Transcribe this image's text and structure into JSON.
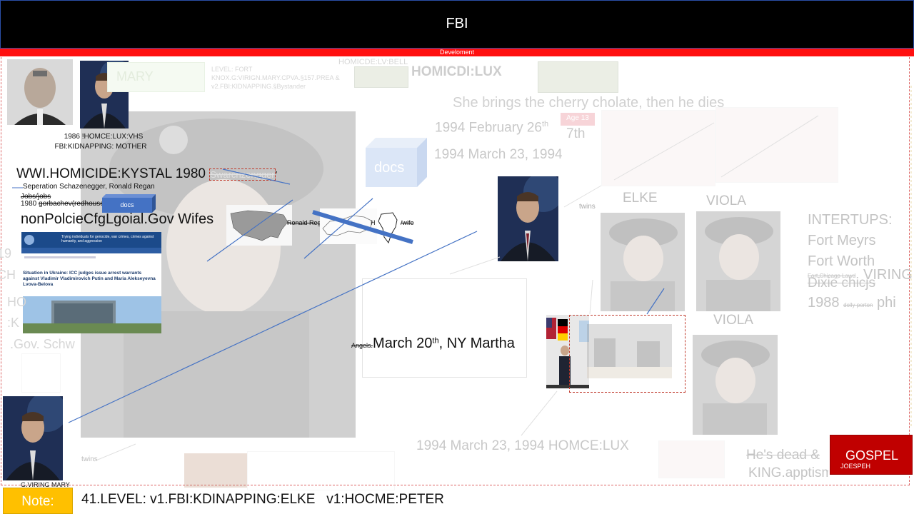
{
  "header": {
    "title": "FBI",
    "banner": "Develoment"
  },
  "left": {
    "photo_caption_line1": "1986 !HOMCE:LUX:VHS",
    "photo_caption_line2": "FBI:KIDNAPPING: MOTHER",
    "homicide_heading": "WWI.HOMICIDE:KYSTAL 1980",
    "homicide_struck": "Swarchzengger",
    "separation_note": "Seperation Schazenegger, Ronald Regan",
    "jobs_note": "Jobs/jobs",
    "year_note_prefix": "1980",
    "year_note_struck": "gorbachev(redhouse",
    "docs_small": "docs",
    "wifes_heading": "nonPolcieCfgLgoial.Gov Wifes",
    "map_label_regan": "Ronald Regan",
    "map_label_h": "H",
    "map_label_wife": "/wife",
    "news_article": {
      "header_text": "Trying individuals for genocide, war crimes, crimes against humanity, and aggression",
      "headline": "Situation in Ukraine: ICC judges issue arrest warrants against Vladimir Vladimirovich Putin and Maria Alekseyevna Lvova-Belova"
    },
    "ghost_left_1": "19",
    "ghost_left_2": "CH",
    "ghost_left_3": "HO",
    "ghost_left_4": ":K",
    "ghost_left_5": ".Gov. Schw",
    "twins_bottom": "twins",
    "bottom_caption": "G.VIRING MARY"
  },
  "center": {
    "ghost_mary": "MARY",
    "ghost_level": "LEVEL: FORT KNOX.G:VIRIGN.MARY.CPVA.§157.PREA & v2.FBI:KIDNAPPING.§Bystander",
    "ghost_bell": "HOMICDE:LV:BELL",
    "homicide_lux": "HOMICDI:LUX",
    "cherry_line": "She brings the cherry cholate, then he dies",
    "age_badge": "Age 13",
    "date_feb": "1994 February 26",
    "date_feb_sup": "th",
    "date_7th": "7th",
    "date_march": "1994 March 23, 1994",
    "docs_big": "docs",
    "angels_struck": "Angels.",
    "march_text": "March 20",
    "march_sup": "th",
    "march_rest": ", NY Martha",
    "twins_mid": "twins",
    "bottom_date": "1994 March 23, 1994 HOMCE:LUX"
  },
  "right": {
    "label_elke": "ELKE",
    "label_viola_1": "VIOLA",
    "label_viola_2": "VIOLA",
    "intertups_title": "INTERTUPS:",
    "intertups_1": "Fort Meyrs",
    "intertups_2": "Fort Worth",
    "intertups_struck_small": "Fort Chicagp Lawd",
    "intertups_struck": "Dixie chicjs",
    "viring": "VIRING",
    "year_1988": "1988",
    "dolly": "dolly porton",
    "phi": "phi",
    "hes_dead": "He's dead &",
    "king_line": "KING.apptism.2.MARY.",
    "gospel_title": "GOSPEL",
    "gospel_sub": "JOESPEH"
  },
  "footer": {
    "note_label": "Note:",
    "note_text": "41.LEVEL: v1.FBI:KDINAPPING:ELKE   v1:HOCME:PETER"
  },
  "colors": {
    "header_bg": "#000000",
    "banner_bg": "#ff1010",
    "note_bg": "#ffc000",
    "gospel_bg": "#c00000",
    "line_blue": "#4472c4"
  }
}
